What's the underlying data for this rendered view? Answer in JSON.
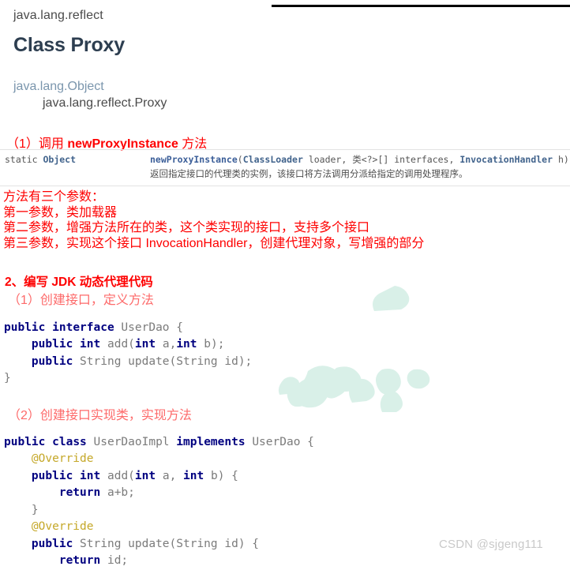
{
  "javadoc": {
    "package": "java.lang.reflect",
    "class_title": "Class Proxy",
    "hierarchy_root": "java.lang.Object",
    "hierarchy_child": "java.lang.reflect.Proxy"
  },
  "section1": {
    "heading_prefix": "（1）调用 ",
    "heading_method": "newProxyInstance",
    "heading_suffix": " 方法",
    "table": {
      "modifier_static": "static ",
      "modifier_type": "Object",
      "signature": "newProxyInstance(ClassLoader loader, 类<?>[] interfaces, InvocationHandler h)",
      "sig_name": "newProxyInstance",
      "sig_rest_1": "(",
      "sig_type_1": "ClassLoader",
      "sig_rest_2": " loader, 类<?>[] interfaces, ",
      "sig_type_2": "InvocationHandler",
      "sig_rest_3": " h)",
      "description": "返回指定接口的代理类的实例，该接口将方法调用分派给指定的调用处理程序。"
    },
    "notes": [
      "方法有三个参数：",
      "第一参数，类加载器",
      "第二参数，增强方法所在的类，这个类实现的接口，支持多个接口",
      "第三参数，实现这个接口 InvocationHandler，创建代理对象，写增强的部分"
    ]
  },
  "section2": {
    "heading": "2、编写 JDK 动态代理代码",
    "sub1": "（1）创建接口，定义方法",
    "sub2": "（2）创建接口实现类，实现方法",
    "code_interface": [
      {
        "tokens": [
          {
            "t": "public",
            "c": "kw"
          },
          {
            "t": " ",
            "c": "pun"
          },
          {
            "t": "interface",
            "c": "kw"
          },
          {
            "t": " UserDao {",
            "c": "id"
          }
        ]
      },
      {
        "tokens": [
          {
            "t": "    ",
            "c": "pun"
          },
          {
            "t": "public",
            "c": "kw"
          },
          {
            "t": " ",
            "c": "pun"
          },
          {
            "t": "int",
            "c": "kw"
          },
          {
            "t": " add(",
            "c": "id"
          },
          {
            "t": "int",
            "c": "kw"
          },
          {
            "t": " a,",
            "c": "id"
          },
          {
            "t": "int",
            "c": "kw"
          },
          {
            "t": " b);",
            "c": "id"
          }
        ]
      },
      {
        "tokens": [
          {
            "t": "    ",
            "c": "pun"
          },
          {
            "t": "public",
            "c": "kw"
          },
          {
            "t": " String update(String id);",
            "c": "id"
          }
        ]
      },
      {
        "tokens": [
          {
            "t": "}",
            "c": "id"
          }
        ]
      }
    ],
    "code_impl": [
      {
        "tokens": [
          {
            "t": "public",
            "c": "kw"
          },
          {
            "t": " ",
            "c": "pun"
          },
          {
            "t": "class",
            "c": "kw"
          },
          {
            "t": " UserDaoImpl ",
            "c": "id"
          },
          {
            "t": "implements",
            "c": "kw"
          },
          {
            "t": " UserDao {",
            "c": "id"
          }
        ]
      },
      {
        "tokens": [
          {
            "t": "    ",
            "c": "pun"
          },
          {
            "t": "@Override",
            "c": "ann"
          }
        ]
      },
      {
        "tokens": [
          {
            "t": "    ",
            "c": "pun"
          },
          {
            "t": "public",
            "c": "kw"
          },
          {
            "t": " ",
            "c": "pun"
          },
          {
            "t": "int",
            "c": "kw"
          },
          {
            "t": " add(",
            "c": "id"
          },
          {
            "t": "int",
            "c": "kw"
          },
          {
            "t": " a, ",
            "c": "id"
          },
          {
            "t": "int",
            "c": "kw"
          },
          {
            "t": " b) {",
            "c": "id"
          }
        ]
      },
      {
        "tokens": [
          {
            "t": "        ",
            "c": "pun"
          },
          {
            "t": "return",
            "c": "kw"
          },
          {
            "t": " a+b;",
            "c": "id"
          }
        ]
      },
      {
        "tokens": [
          {
            "t": "    }",
            "c": "id"
          }
        ]
      },
      {
        "tokens": [
          {
            "t": "    ",
            "c": "pun"
          },
          {
            "t": "@Override",
            "c": "ann"
          }
        ]
      },
      {
        "tokens": [
          {
            "t": "    ",
            "c": "pun"
          },
          {
            "t": "public",
            "c": "kw"
          },
          {
            "t": " String update(String id) {",
            "c": "id"
          }
        ]
      },
      {
        "tokens": [
          {
            "t": "        ",
            "c": "pun"
          },
          {
            "t": "return",
            "c": "kw"
          },
          {
            "t": " id;",
            "c": "id"
          }
        ]
      }
    ]
  },
  "watermark": {
    "text": "CSDN @sjgeng111"
  },
  "colors": {
    "red": "#fe0000",
    "light_red": "#fd6a6a",
    "keyword_navy": "#000080",
    "identifier_gray": "#7b7b7b",
    "annotation_gold": "#c5a829",
    "title_navy": "#2d3e50",
    "link_blue": "#7b96ad",
    "watermark_gray": "#c9c9c9",
    "watermark_mint": "#d8f0e8"
  }
}
